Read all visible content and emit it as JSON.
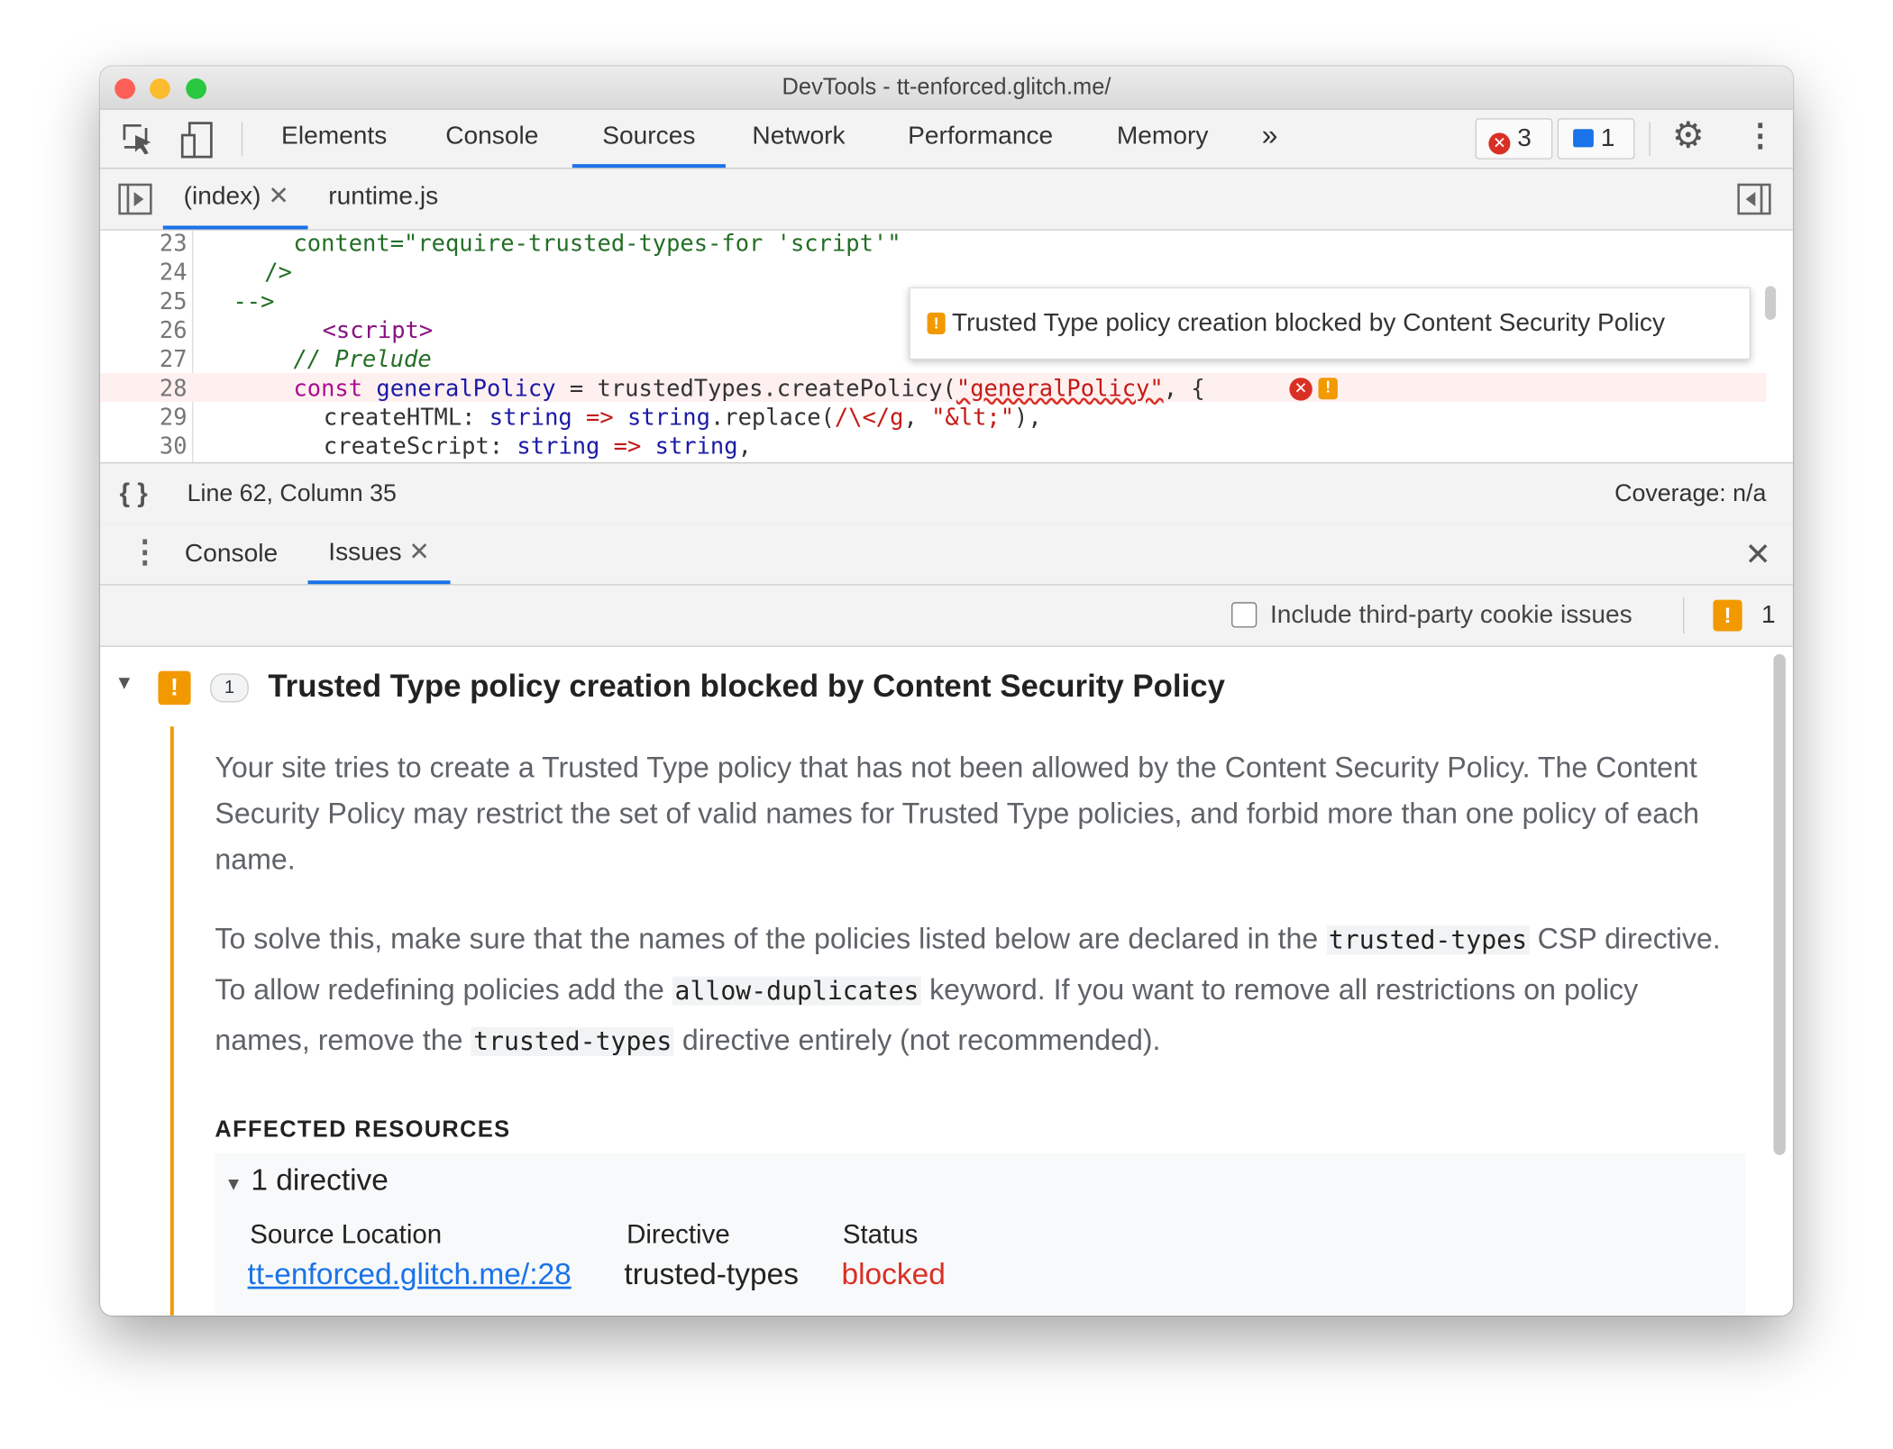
{
  "window": {
    "title": "DevTools - tt-enforced.glitch.me/"
  },
  "toolbar": {
    "tabs": [
      "Elements",
      "Console",
      "Sources",
      "Network",
      "Performance",
      "Memory"
    ],
    "active": "Sources",
    "more": "»",
    "error_count": "3",
    "message_count": "1"
  },
  "file_tabs": [
    {
      "label": "(index)",
      "closable": true,
      "active": true
    },
    {
      "label": "runtime.js"
    }
  ],
  "code": {
    "lines": [
      {
        "n": "23"
      },
      {
        "n": "24"
      },
      {
        "n": "25"
      },
      {
        "n": "26"
      },
      {
        "n": "27"
      },
      {
        "n": "28"
      },
      {
        "n": "29"
      },
      {
        "n": "30"
      }
    ],
    "l23": "content=\"require-trusted-types-for 'script'\"",
    "l24": "/>",
    "l25": "-->",
    "l26": "<script>",
    "l27": "// Prelude",
    "l28a": "const",
    "l28b": "generalPolicy",
    "l28c": " = trustedTypes.createPolicy(",
    "l28d": "\"generalPolicy\"",
    "l28e": ", {",
    "l29a": "createHTML: ",
    "l29b": "string",
    "l29c": " => ",
    "l29d": "string",
    ".": "",
    "l29e": ".replace(",
    "l29f": "/\\</g",
    "l29g": ", ",
    "l29h": "\"&lt;\"",
    "l29i": "),",
    "l30a": "createScript: ",
    "l30b": "string",
    "l30c": " => ",
    "l30d": "string",
    "l30e": ",",
    "tooltip": "Trusted Type policy creation blocked by Content Security Policy"
  },
  "status": {
    "position": "Line 62, Column 35",
    "coverage": "Coverage: n/a"
  },
  "drawer": {
    "tabs": [
      "Console",
      "Issues"
    ],
    "active": "Issues"
  },
  "issues": {
    "checkbox_label": "Include third-party cookie issues",
    "checked": false,
    "warning_count": "1",
    "issue": {
      "title": "Trusted Type policy creation blocked by Content Security Policy",
      "count": "1",
      "p1": "Your site tries to create a Trusted Type policy that has not been allowed by the Content Security Policy. The Content Security Policy may restrict the set of valid names for Trusted Type policies, and forbid more than one policy of each name.",
      "p2a": "To solve this, make sure that the names of the policies listed below are declared in the ",
      "p2code1": "trusted-types",
      "p2b": " CSP directive. To allow redefining policies add the ",
      "p2code2": "allow-duplicates",
      "p2c": " keyword. If you want to remove all restrictions on policy names, remove the ",
      "p2code3": "trusted-types",
      "p2d": " directive entirely (not recommended).",
      "affected_heading": "AFFECTED RESOURCES",
      "group": "1 directive",
      "columns": [
        "Source Location",
        "Directive",
        "Status"
      ],
      "row": {
        "source": "tt-enforced.glitch.me/:28",
        "directive": "trusted-types",
        "status": "blocked"
      }
    }
  },
  "colors": {
    "accent": "#1a73e8",
    "warning": "#f29900",
    "error": "#d93025"
  }
}
